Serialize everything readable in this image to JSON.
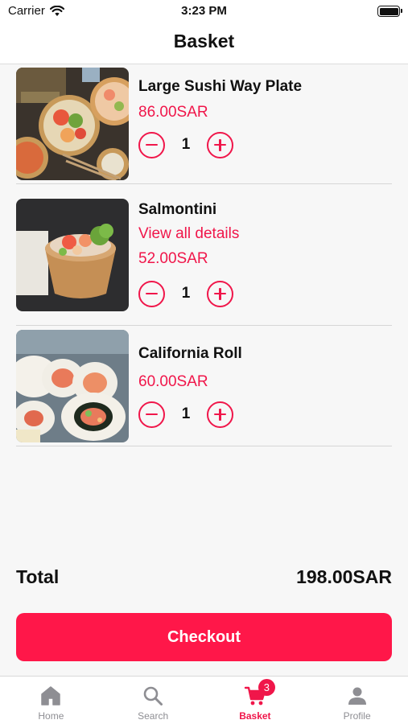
{
  "status_bar": {
    "carrier": "Carrier",
    "time": "3:23 PM"
  },
  "nav": {
    "title": "Basket"
  },
  "items": [
    {
      "name": "Large Sushi Way Plate",
      "price": "86.00SAR",
      "quantity": "1"
    },
    {
      "name": "Salmontini",
      "details_link": "View all details",
      "price": "52.00SAR",
      "quantity": "1"
    },
    {
      "name": "California Roll",
      "price": "60.00SAR",
      "quantity": "1"
    }
  ],
  "summary": {
    "total_label": "Total",
    "total_value": "198.00SAR"
  },
  "checkout": {
    "label": "Checkout"
  },
  "tabs": [
    {
      "label": "Home",
      "icon": "home-icon"
    },
    {
      "label": "Search",
      "icon": "search-icon"
    },
    {
      "label": "Basket",
      "icon": "cart-icon",
      "badge": "3",
      "active": true
    },
    {
      "label": "Profile",
      "icon": "person-icon"
    }
  ],
  "colors": {
    "accent": "#f0164a",
    "button": "#ff1749",
    "background": "#f7f7f7",
    "tab_inactive": "#8e8e93"
  }
}
